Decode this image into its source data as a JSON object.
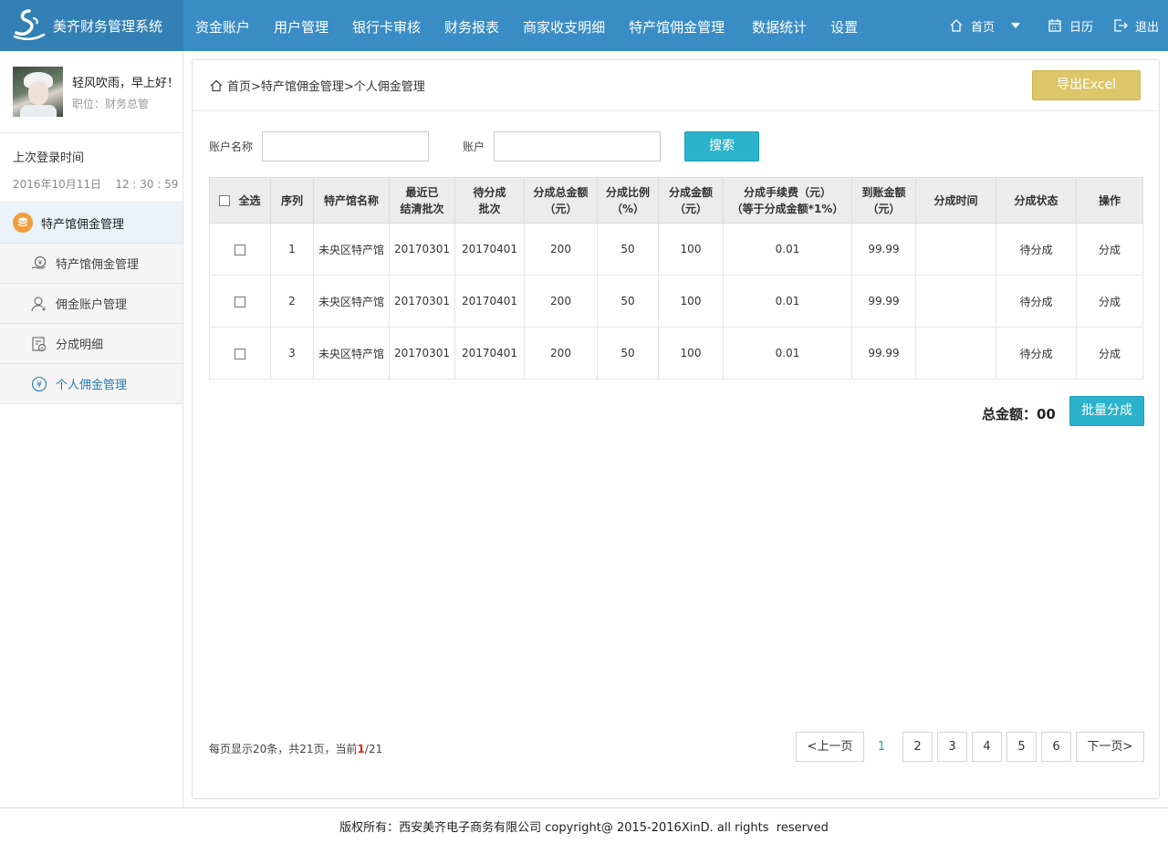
{
  "app": {
    "title": "美齐财务管理系统"
  },
  "nav": {
    "items": [
      "资金账户",
      "用户管理",
      "银行卡审核",
      "财务报表",
      "商家收支明细",
      "特产馆佣金管理",
      "数据统计",
      "设置"
    ],
    "home": "首页",
    "calendar": "日历",
    "logout": "退出"
  },
  "profile": {
    "greeting": "轻风吹雨，早上好！",
    "position": "职位：财务总管",
    "last_login_label": "上次登录时间",
    "last_login_time": "2016年10月11日    12 : 30 : 59"
  },
  "sidebar": {
    "group": "特产馆佣金管理",
    "items": [
      {
        "label": "特产馆佣金管理",
        "icon": "hand-coin-icon"
      },
      {
        "label": "佣金账户管理",
        "icon": "user-yen-icon"
      },
      {
        "label": "分成明细",
        "icon": "document-yen-icon"
      },
      {
        "label": "个人佣金管理",
        "icon": "yen-circle-icon"
      }
    ]
  },
  "breadcrumb": "首页>特产馆佣金管理>个人佣金管理",
  "export_label": "导出Excel",
  "search": {
    "account_name_label": "账户名称",
    "account_label": "账户",
    "button": "搜索"
  },
  "table": {
    "headers": {
      "select_all": "全选",
      "index": "序列",
      "store": "特产馆名称",
      "last_batch_1": "最近已",
      "last_batch_2": "结清批次",
      "pending_batch_1": "待分成",
      "pending_batch_2": "批次",
      "total_1": "分成总金额",
      "total_2": "（元）",
      "ratio_1": "分成比例",
      "ratio_2": "（%）",
      "amount_1": "分成金额",
      "amount_2": "（元）",
      "fee_1": "分成手续费（元）",
      "fee_2": "（等于分成金额*1%）",
      "received_1": "到账金额",
      "received_2": "（元）",
      "time": "分成时间",
      "status": "分成状态",
      "op": "操作"
    },
    "rows": [
      {
        "index": "1",
        "store": "未央区特产馆",
        "last_batch": "20170301",
        "pending_batch": "20170401",
        "total": "200",
        "ratio": "50",
        "amount": "100",
        "fee": "0.01",
        "received": "99.99",
        "time": "",
        "status": "待分成",
        "op": "分成"
      },
      {
        "index": "2",
        "store": "未央区特产馆",
        "last_batch": "20170301",
        "pending_batch": "20170401",
        "total": "200",
        "ratio": "50",
        "amount": "100",
        "fee": "0.01",
        "received": "99.99",
        "time": "",
        "status": "待分成",
        "op": "分成"
      },
      {
        "index": "3",
        "store": "未央区特产馆",
        "last_batch": "20170301",
        "pending_batch": "20170401",
        "total": "200",
        "ratio": "50",
        "amount": "100",
        "fee": "0.01",
        "received": "99.99",
        "time": "",
        "status": "待分成",
        "op": "分成"
      }
    ]
  },
  "summary": {
    "total_label": "总金额：00",
    "batch_button": "批量分成"
  },
  "pagination": {
    "info_prefix": "每页显示20条，共21页，当前",
    "current": "1",
    "info_suffix": "/21",
    "prev": "<上一页",
    "next": "下一页>",
    "pages": [
      "1",
      "2",
      "3",
      "4",
      "5",
      "6"
    ]
  },
  "footer": "版权所有：西安美齐电子商务有限公司 copyright@ 2015-2016XinD. all rights  reserved",
  "colors": {
    "topbar": "#3a8dc4",
    "accent": "#2ab3cb",
    "export": "#dcc66a",
    "pending": "#e8211f",
    "link": "#2a9fc3"
  }
}
